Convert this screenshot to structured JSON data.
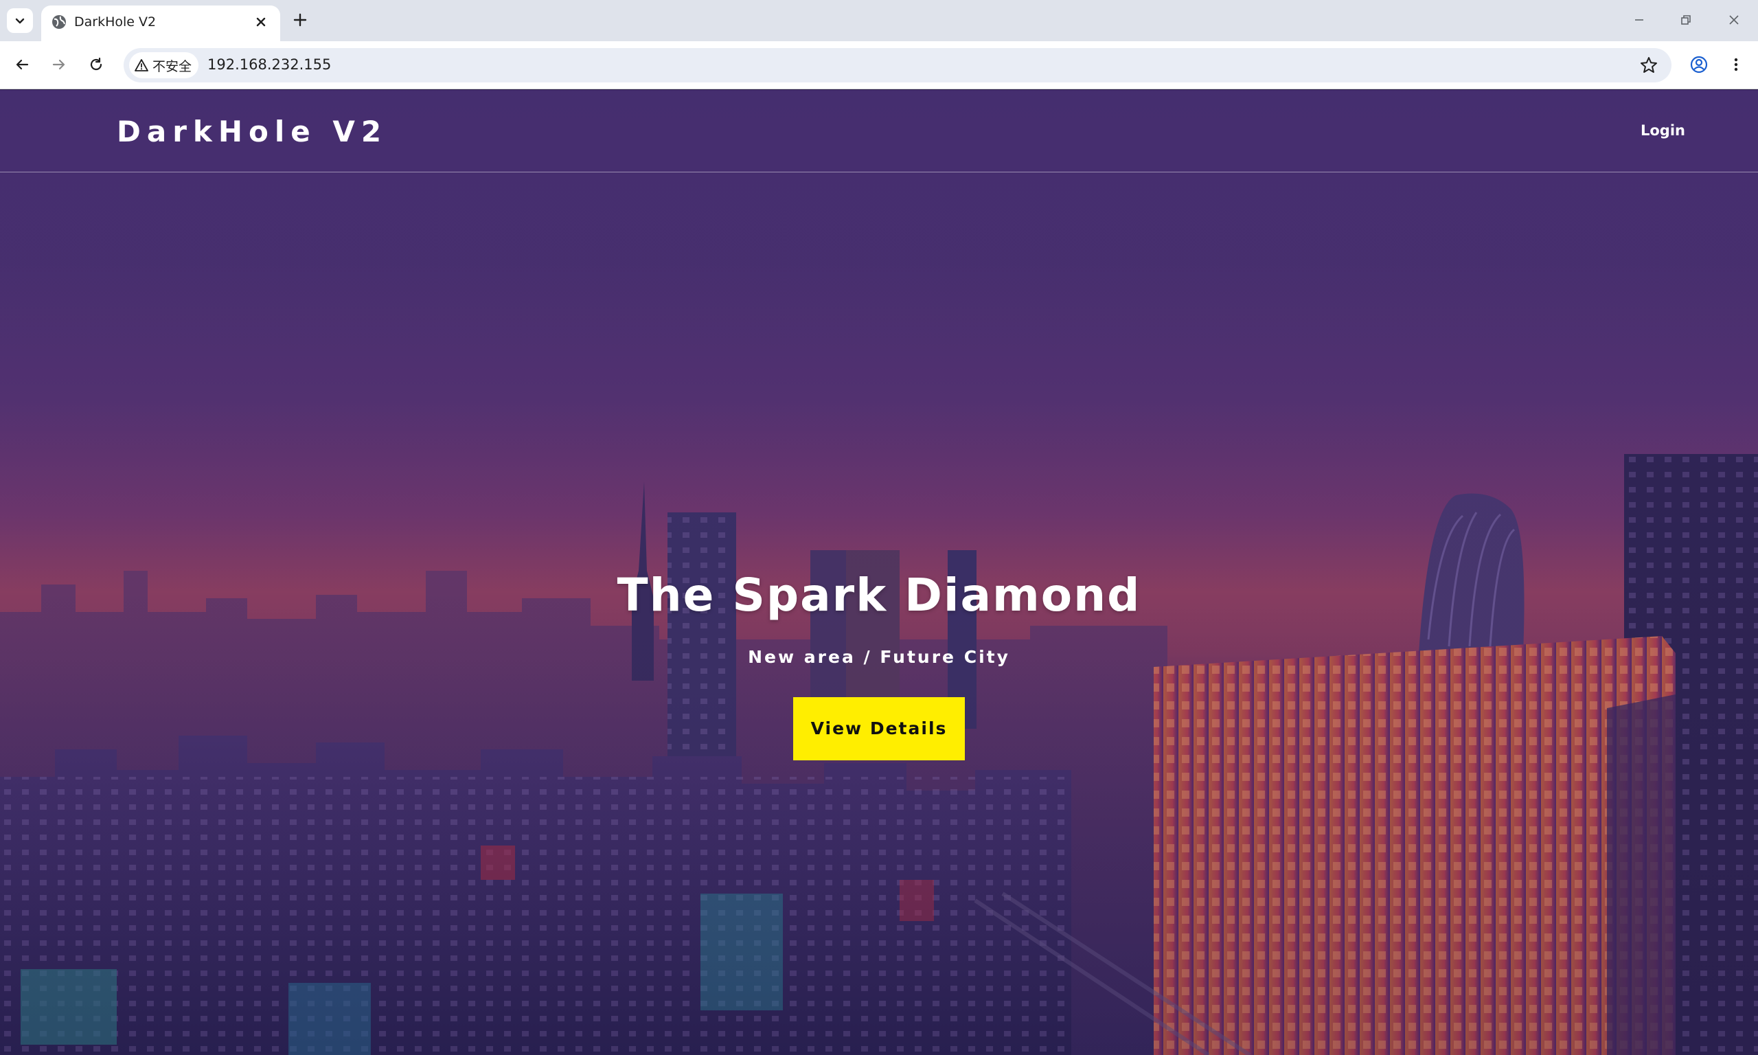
{
  "browser": {
    "tab_title": "DarkHole V2",
    "security_label": "不安全",
    "url": "192.168.232.155",
    "icons": [
      "tab-search-icon",
      "globe-icon",
      "close-icon",
      "plus-icon",
      "minimize-icon",
      "restore-icon",
      "window-close-icon",
      "back-arrow-icon",
      "forward-arrow-icon",
      "reload-icon",
      "warning-icon",
      "star-icon",
      "profile-icon",
      "kebab-menu-icon"
    ]
  },
  "site": {
    "brand": "DarkHole V2",
    "nav": {
      "login": "Login"
    }
  },
  "hero": {
    "title": "The Spark Diamond",
    "subtitle": "New area / Future City",
    "cta": "View Details"
  },
  "colors": {
    "cta_background": "#ffee00",
    "hero_top": "#4a3170",
    "hero_horizon": "#9a4360",
    "hero_bottom": "#2c2450"
  }
}
